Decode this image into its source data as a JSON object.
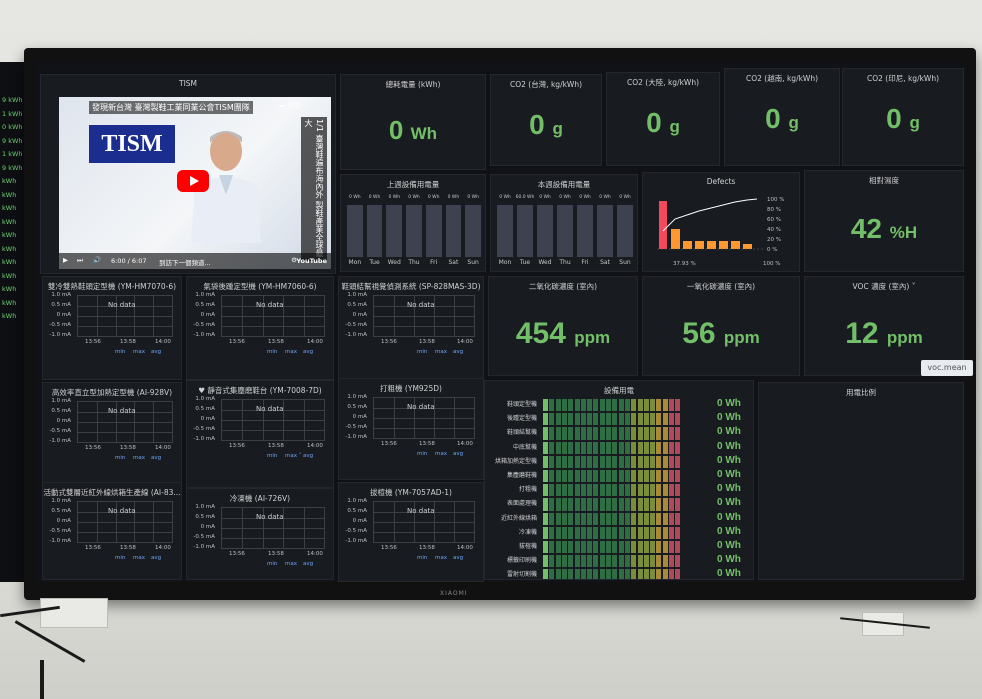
{
  "left_monitor": {
    "values": [
      "9 kWh",
      "1 kWh",
      "0 kWh",
      "9 kWh",
      "1 kWh",
      "9 kWh",
      "kWh",
      "kWh",
      "kWh",
      "kWh",
      "kWh",
      "kWh",
      "kWh",
      "kWh",
      "kWh",
      "kWh",
      "kWh"
    ]
  },
  "video": {
    "panel_title": "TISM",
    "video_title": "發現新台灣 臺灣製鞋工業同業公會TISM團隊",
    "logo_text": "TISM",
    "share": "分享",
    "page": "1/1",
    "vertical_caption": "臺灣鞋遍布海內外 製鞋產業全球最大",
    "time": "6:00 / 6:07",
    "caption_bar": "到訪下一個頻道...",
    "platform": "YouTube"
  },
  "total_power": {
    "title": "總耗電量 (kWh)",
    "value": "0",
    "unit": "Wh"
  },
  "co2": [
    {
      "title": "CO2 (台灣, kg/kWh)",
      "value": "0",
      "unit": "g"
    },
    {
      "title": "CO2 (大陸, kg/kWh)",
      "value": "0",
      "unit": "g"
    },
    {
      "title": "CO2 (越南, kg/kWh)",
      "value": "0",
      "unit": "g"
    },
    {
      "title": "CO2 (印尼, kg/kWh)",
      "value": "0",
      "unit": "g"
    }
  ],
  "last_week": {
    "title": "上週設備用電量",
    "days": [
      "Mon",
      "Tue",
      "Wed",
      "Thu",
      "Fri",
      "Sat",
      "Sun"
    ],
    "tops": [
      "0 Wh",
      "0 Wh",
      "0 Wh",
      "0 Wh",
      "0 Wh",
      "0 Wh",
      "0 Wh"
    ]
  },
  "this_week": {
    "title": "本週設備用電量",
    "days": [
      "Mon",
      "Tue",
      "Wed",
      "Thu",
      "Fri",
      "Sat",
      "Sun"
    ],
    "tops": [
      "0 Wh",
      "60.0 Wh",
      "0 Wh",
      "0 Wh",
      "0 Wh",
      "0 Wh",
      "0 Wh"
    ]
  },
  "defects": {
    "title": "Defects",
    "right_ticks": [
      "100 %",
      "80 %",
      "60 %",
      "40 %",
      "20 %",
      "0 %"
    ],
    "footer_left": "37.93 %",
    "footer_right": "100 %"
  },
  "humidity": {
    "title": "相對濕度",
    "value": "42",
    "unit": "%H"
  },
  "co2_conc": {
    "title": "二氧化碳濃度 (室內)",
    "value": "454",
    "unit": "ppm"
  },
  "co_conc": {
    "title": "一氧化碳濃度 (室內)",
    "value": "56",
    "unit": "ppm"
  },
  "voc": {
    "title": "VOC 濃度 (室內)",
    "value": "12",
    "unit": "ppm",
    "tooltip": "voc.mean"
  },
  "machines": [
    {
      "title": "雙冷雙熱鞋頭定型機 (YM-HM7070-6)"
    },
    {
      "title": "氣袋後踵定型機 (YM-HM7060-6)"
    },
    {
      "title": "鞋頭結幫視覺偵測系統 (SP-828MAS-3D)"
    },
    {
      "title": "高效率直立型加熱定型機 (AI-928V)"
    },
    {
      "title": "♥ 靜音式集塵磨鞋台 (YM-7008-7D)"
    },
    {
      "title": "打粗機 (YM925D)"
    },
    {
      "title": "活動式雙層近紅外線烘箱生產線 (AI-83..."
    },
    {
      "title": "冷凍機 (AI-726V)"
    },
    {
      "title": "拔楦機 (YM-7057AD-1)"
    }
  ],
  "machine_axes": {
    "y": [
      "1.0 mA",
      "0.5 mA",
      "0 mA",
      "-0.5 mA",
      "-1.0 mA"
    ],
    "x": [
      "13:56",
      "13:58",
      "14:00"
    ],
    "nodata": "No data",
    "legend": [
      "min",
      "max",
      "avg"
    ],
    "legend_max_variant": "max ˅"
  },
  "equipment_power": {
    "title": "設備用電",
    "rows": [
      {
        "label": "鞋頭定型機",
        "value": "0 Wh"
      },
      {
        "label": "後踵定型機",
        "value": "0 Wh"
      },
      {
        "label": "鞋頭結幫機",
        "value": "0 Wh"
      },
      {
        "label": "中底幫機",
        "value": "0 Wh"
      },
      {
        "label": "烘箱加熱定型機",
        "value": "0 Wh"
      },
      {
        "label": "集塵磨鞋機",
        "value": "0 Wh"
      },
      {
        "label": "打粗機",
        "value": "0 Wh"
      },
      {
        "label": "表面處理機",
        "value": "0 Wh"
      },
      {
        "label": "近紅外線烘箱",
        "value": "0 Wh"
      },
      {
        "label": "冷凍機",
        "value": "0 Wh"
      },
      {
        "label": "拔楦機",
        "value": "0 Wh"
      },
      {
        "label": "標籤印刷機",
        "value": "0 Wh"
      },
      {
        "label": "雷射切割機",
        "value": "0 Wh"
      }
    ]
  },
  "ratio": {
    "title": "用電比例"
  },
  "brand": "XIAOMI",
  "colors": {
    "green": "#73bf69",
    "panel": "#181b1f",
    "orange": "#ff9830",
    "red": "#f2495c"
  }
}
